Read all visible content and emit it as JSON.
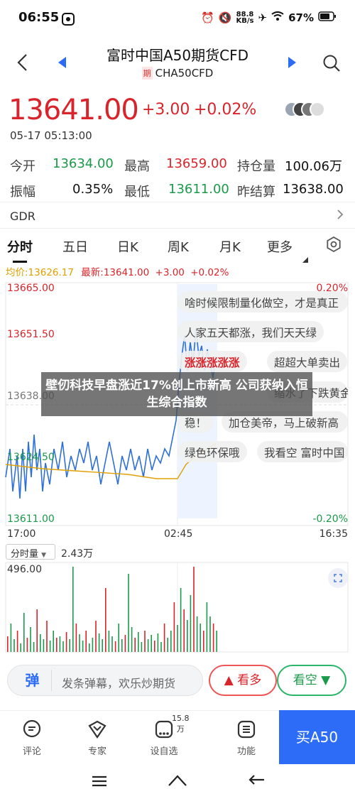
{
  "status": {
    "time": "06:55",
    "network_speed": "88.8",
    "network_unit": "KB/s",
    "battery": "67%"
  },
  "header": {
    "title": "富时中国A50期货CFD",
    "tag": "期",
    "code": "CHA50CFD"
  },
  "quote": {
    "price": "13641.00",
    "change": "+3.00",
    "change_pct": "+0.02%",
    "timestamp": "05-17 05:13:00"
  },
  "stats": {
    "open_label": "今开",
    "open": "13634.00",
    "high_label": "最高",
    "high": "13659.00",
    "oi_label": "持仓量",
    "oi": "100.06万",
    "amp_label": "振幅",
    "amp": "0.35%",
    "low_label": "最低",
    "low": "13611.00",
    "prev_label": "昨结算",
    "prev": "13638.00"
  },
  "gdr": {
    "label": "GDR"
  },
  "tabs": [
    "分时",
    "五日",
    "日K",
    "周K",
    "月K",
    "更多"
  ],
  "info": {
    "avg": "均价:13626.17",
    "latest": "最新:13641.00",
    "chg": "+3.00",
    "pct": "+0.02%"
  },
  "axis": {
    "y_top": "13665.00",
    "y_2": "13651.50",
    "y_mid": "13638.00",
    "y_4": "13624.50",
    "y_bot": "13611.00",
    "pct_top": "0.20%",
    "pct_bot": "-0.20%",
    "t_start": "17:00",
    "t_mid": "02:45",
    "t_end": "16:35"
  },
  "volume": {
    "selector": "分时量",
    "value": "2.43万",
    "max": "496.00"
  },
  "banner": {
    "text": "壁仞科技早盘涨近17%创上市新高 公司获纳入恒生综合指数"
  },
  "danmu": [
    "啥时候限制量化做空，才是真正",
    "人家五天都涨，我们天天绿",
    "涨涨涨涨涨",
    "超超大单卖出",
    "缩水了下跌黄金跌",
    "稳！",
    "加仓美帝，马上破新高",
    "绿色环保哦",
    "我看空 富时中国"
  ],
  "input": {
    "badge": "弹",
    "placeholder": "发条弹幕，欢乐炒期货",
    "bull": "看多",
    "bear": "看空"
  },
  "nav": [
    {
      "label": "评论"
    },
    {
      "label": "专家"
    },
    {
      "label": "设自选",
      "badge": "15.8万"
    },
    {
      "label": "功能"
    }
  ],
  "buy": {
    "label": "买A50"
  },
  "colors": {
    "up": "#d8242a",
    "down": "#1a9a4a",
    "line": "#2f6fd8",
    "avg": "#e0a000",
    "buy": "#2d6cf6"
  }
}
